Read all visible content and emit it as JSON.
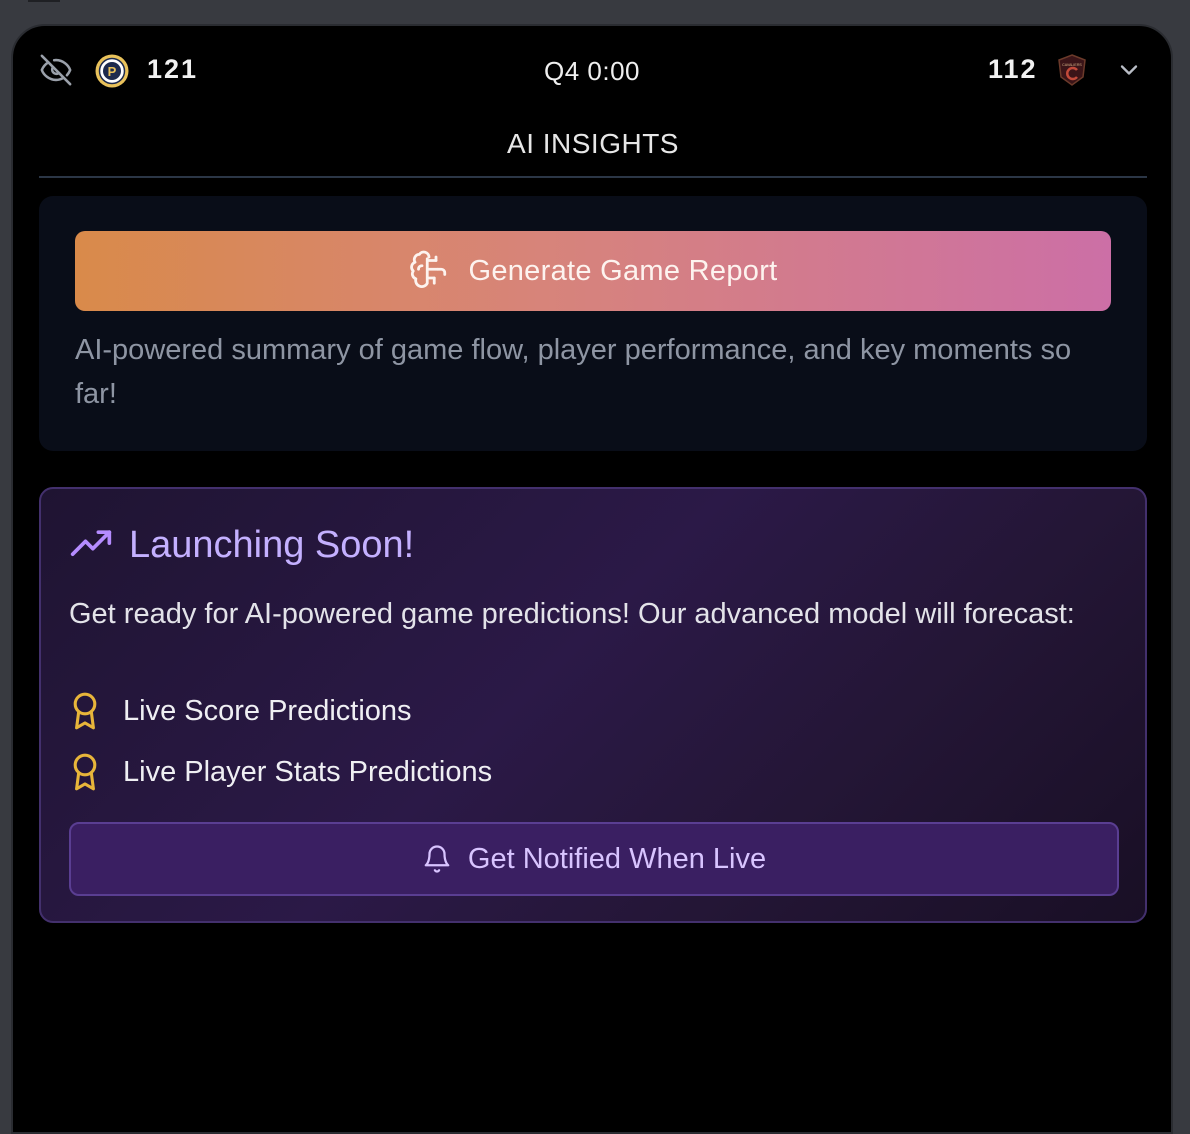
{
  "scoreboard": {
    "home_score": "121",
    "away_score": "112",
    "clock": "Q4 0:00",
    "home_logo_text": "P",
    "away_logo_text": "CAVALIERS"
  },
  "section_title": "AI INSIGHTS",
  "report": {
    "button_label": "Generate Game Report",
    "description": "AI-powered summary of game flow, player performance, and key moments so far!"
  },
  "launch": {
    "title": "Launching Soon!",
    "description": "Get ready for AI-powered game predictions! Our advanced model will forecast:",
    "features": [
      {
        "label": "Live Score Predictions",
        "icon": "award-icon"
      },
      {
        "label": "Live Player Stats Predictions",
        "icon": "award-icon"
      }
    ],
    "notify_label": "Get Notified When Live"
  },
  "icons": {
    "visibility": "eye-off-icon",
    "expand": "chevron-down-icon",
    "report": "brain-icon",
    "trend": "trending-up-icon",
    "notify": "bell-icon"
  },
  "colors": {
    "background": "#000000",
    "gradient_start": "#d98a4a",
    "gradient_end": "#cc6fa6",
    "accent_purple": "#c4b0ff",
    "award_gold": "#e8b53a"
  }
}
